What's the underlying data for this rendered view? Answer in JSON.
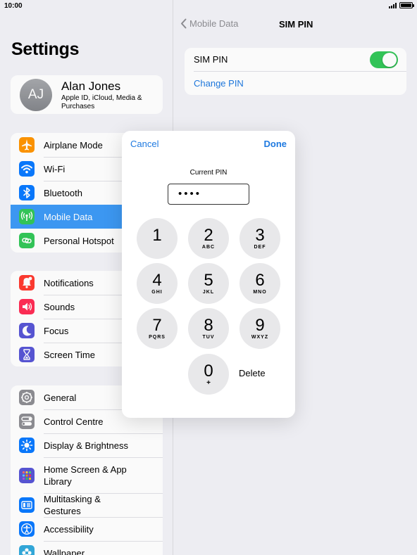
{
  "status": {
    "time": "10:00"
  },
  "sidebar": {
    "title": "Settings",
    "profile": {
      "initials": "AJ",
      "name": "Alan Jones",
      "subtitle": "Apple ID, iCloud, Media & Purchases"
    },
    "groups": [
      [
        {
          "label": "Airplane Mode",
          "icon": "airplane-icon",
          "color": "#ff9500"
        },
        {
          "label": "Wi-Fi",
          "icon": "wifi-icon",
          "color": "#0a7aff"
        },
        {
          "label": "Bluetooth",
          "icon": "bluetooth-icon",
          "color": "#0a7aff"
        },
        {
          "label": "Mobile Data",
          "icon": "antenna-icon",
          "color": "#34c759",
          "selected": true
        },
        {
          "label": "Personal Hotspot",
          "icon": "hotspot-icon",
          "color": "#34c759"
        }
      ],
      [
        {
          "label": "Notifications",
          "icon": "bell-icon",
          "color": "#ff3b30"
        },
        {
          "label": "Sounds",
          "icon": "speaker-icon",
          "color": "#ff2d55"
        },
        {
          "label": "Focus",
          "icon": "moon-icon",
          "color": "#5856d6"
        },
        {
          "label": "Screen Time",
          "icon": "hourglass-icon",
          "color": "#5856d6"
        }
      ],
      [
        {
          "label": "General",
          "icon": "gear-icon",
          "color": "#8e8e93"
        },
        {
          "label": "Control Centre",
          "icon": "toggles-icon",
          "color": "#8e8e93"
        },
        {
          "label": "Display & Brightness",
          "icon": "sun-icon",
          "color": "#0a7aff"
        },
        {
          "label": "Home Screen & App Library",
          "icon": "home-grid-icon",
          "color": "#5856d6",
          "tall": true
        },
        {
          "label": "Multitasking & Gestures",
          "icon": "multitask-icon",
          "color": "#0a7aff"
        },
        {
          "label": "Accessibility",
          "icon": "accessibility-icon",
          "color": "#0a7aff"
        },
        {
          "label": "Wallpaper",
          "icon": "flower-icon",
          "color": "#34aadc"
        }
      ]
    ]
  },
  "detail": {
    "back_label": "Mobile Data",
    "title": "SIM PIN",
    "sim_pin_label": "SIM PIN",
    "sim_pin_enabled": true,
    "change_pin_label": "Change PIN"
  },
  "modal": {
    "cancel_label": "Cancel",
    "done_label": "Done",
    "pin_label": "Current PIN",
    "pin_value": "••••",
    "delete_label": "Delete",
    "keys": [
      {
        "digit": "1",
        "letters": ""
      },
      {
        "digit": "2",
        "letters": "ABC"
      },
      {
        "digit": "3",
        "letters": "DEF"
      },
      {
        "digit": "4",
        "letters": "GHI"
      },
      {
        "digit": "5",
        "letters": "JKL"
      },
      {
        "digit": "6",
        "letters": "MNO"
      },
      {
        "digit": "7",
        "letters": "PQRS"
      },
      {
        "digit": "8",
        "letters": "TUV"
      },
      {
        "digit": "9",
        "letters": "WXYZ"
      },
      {
        "digit": "0",
        "letters": "+"
      }
    ]
  },
  "colors": {
    "accent": "#1f7ae0",
    "selected_row": "#3e9bf6",
    "toggle_on": "#34c759"
  }
}
